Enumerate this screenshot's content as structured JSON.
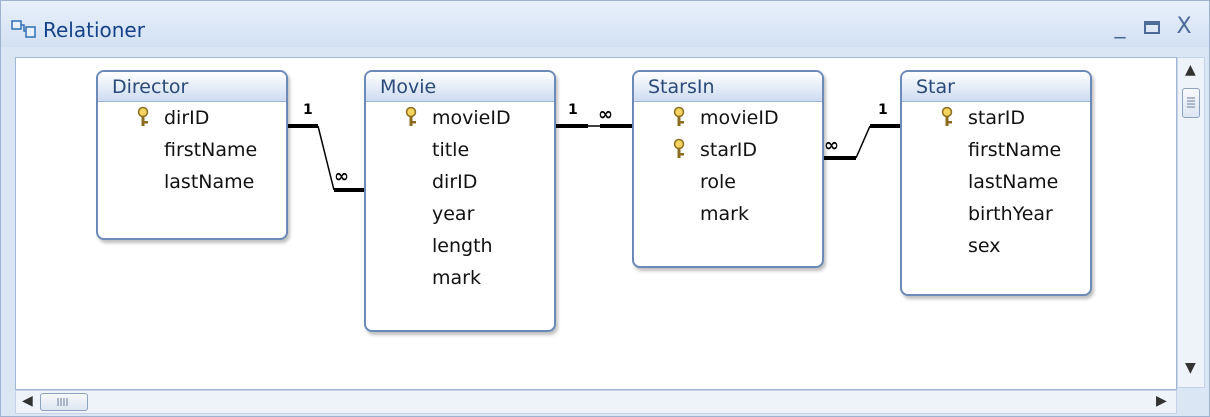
{
  "window": {
    "title": "Relationer",
    "minimize": "_",
    "maximize": "□",
    "close": "X"
  },
  "tables": [
    {
      "name": "Director",
      "fields": [
        {
          "name": "dirID",
          "key": true
        },
        {
          "name": "firstName",
          "key": false
        },
        {
          "name": "lastName",
          "key": false
        }
      ]
    },
    {
      "name": "Movie",
      "fields": [
        {
          "name": "movieID",
          "key": true
        },
        {
          "name": "title",
          "key": false
        },
        {
          "name": "dirID",
          "key": false
        },
        {
          "name": "year",
          "key": false
        },
        {
          "name": "length",
          "key": false
        },
        {
          "name": "mark",
          "key": false
        }
      ]
    },
    {
      "name": "StarsIn",
      "fields": [
        {
          "name": "movieID",
          "key": true
        },
        {
          "name": "starID",
          "key": true
        },
        {
          "name": "role",
          "key": false
        },
        {
          "name": "mark",
          "key": false
        }
      ]
    },
    {
      "name": "Star",
      "fields": [
        {
          "name": "starID",
          "key": true
        },
        {
          "name": "firstName",
          "key": false
        },
        {
          "name": "lastName",
          "key": false
        },
        {
          "name": "birthYear",
          "key": false
        },
        {
          "name": "sex",
          "key": false
        }
      ]
    }
  ],
  "relationships": [
    {
      "from": "Director.dirID",
      "to": "Movie.dirID",
      "one_label": "1",
      "many_label": "∞"
    },
    {
      "from": "Movie.movieID",
      "to": "StarsIn.movieID",
      "one_label": "1",
      "many_label": "∞"
    },
    {
      "from": "Star.starID",
      "to": "StarsIn.starID",
      "one_label": "1",
      "many_label": "∞"
    }
  ]
}
